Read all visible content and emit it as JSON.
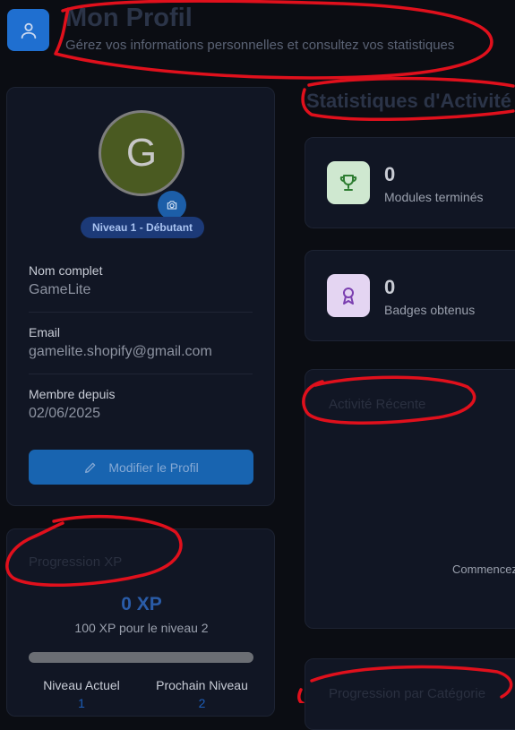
{
  "header": {
    "title": "Mon Profil",
    "subtitle": "Gérez vos informations personnelles et consultez vos statistiques"
  },
  "profile": {
    "avatar_initial": "G",
    "level_badge": "Niveau 1 - Débutant",
    "fields": [
      {
        "label": "Nom complet",
        "value": "GameLite"
      },
      {
        "label": "Email",
        "value": "gamelite.shopify@gmail.com"
      },
      {
        "label": "Membre depuis",
        "value": "02/06/2025"
      }
    ],
    "edit_button": "Modifier le Profil"
  },
  "xp": {
    "title": "Progression XP",
    "value": "0 XP",
    "next_level_text": "100 XP pour le niveau 2",
    "progress": 0,
    "current_level_label": "Niveau Actuel",
    "current_level": "1",
    "next_level_label": "Prochain Niveau",
    "next_level": "2"
  },
  "stats": {
    "title": "Statistiques d'Activité",
    "cards": [
      {
        "value": "0",
        "label": "Modules terminés",
        "icon": "trophy-icon",
        "color": "#2e7d32",
        "bg": "#cfe8d0"
      },
      {
        "value": "0",
        "label": "Badges obtenus",
        "icon": "award-icon",
        "color": "#7b3fb0",
        "bg": "#e4d5f2"
      }
    ]
  },
  "recent": {
    "title": "Activité Récente",
    "empty_text": "Commencez"
  },
  "bottom": {
    "title": "Progression par Catégorie"
  },
  "colors": {
    "accent": "#1f6fd0",
    "background": "#0b0d13",
    "card": "#111624",
    "annotation": "#e0101c"
  }
}
